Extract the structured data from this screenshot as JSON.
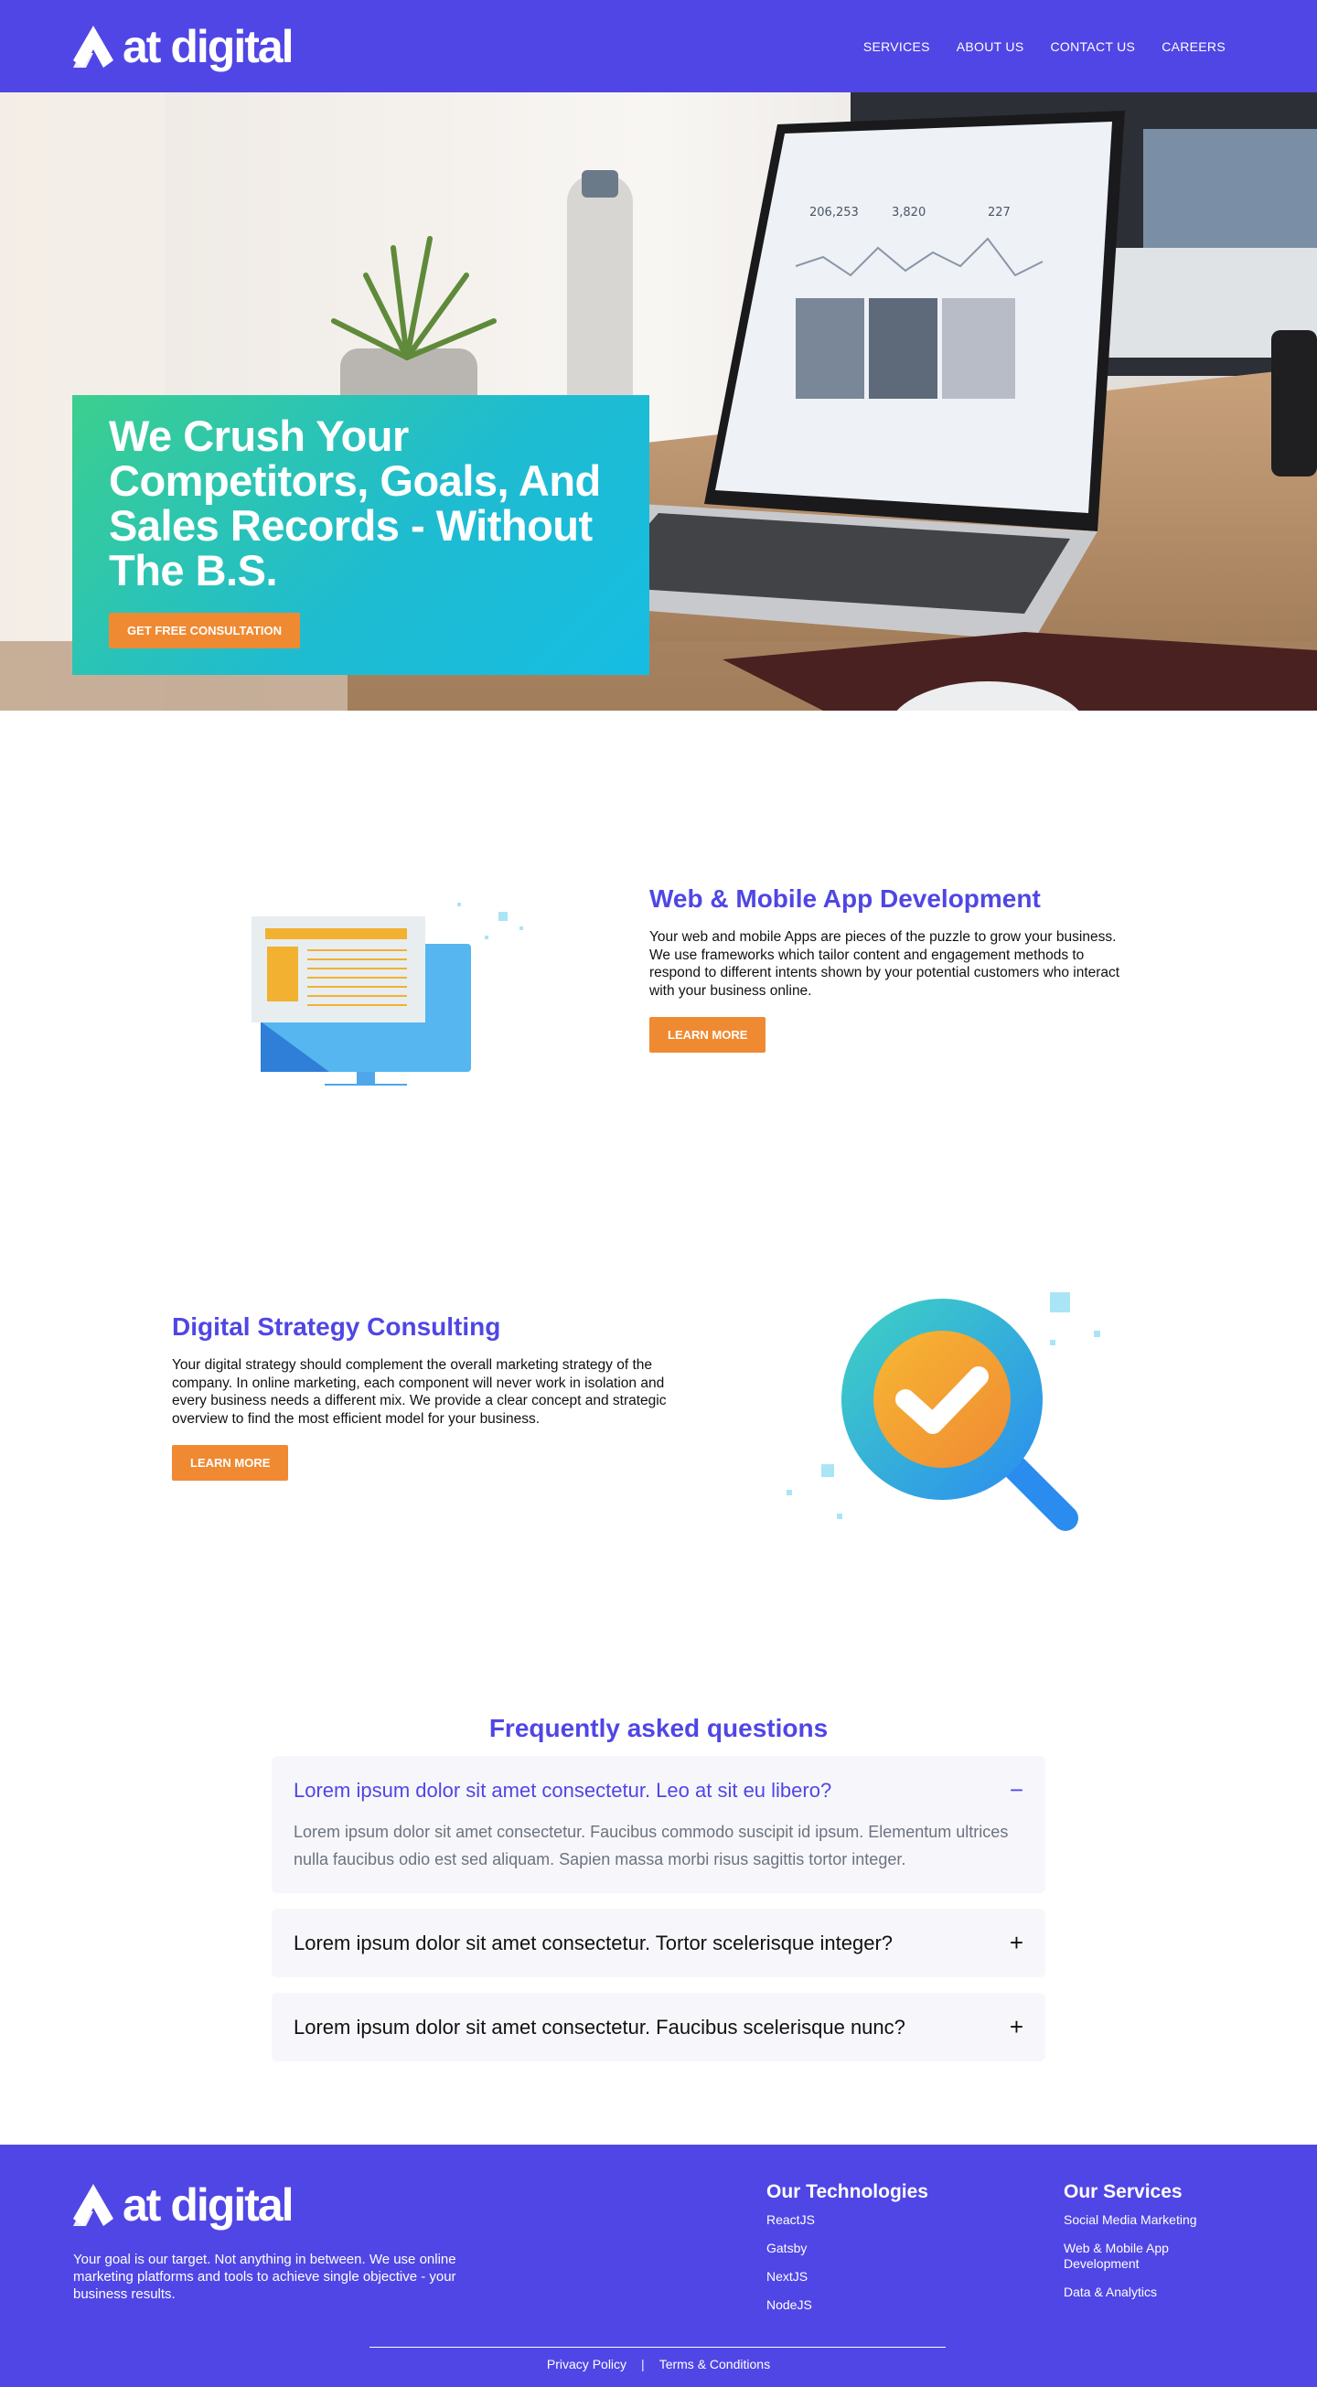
{
  "header": {
    "logo_text": "at digital",
    "nav": [
      "SERVICES",
      "ABOUT US",
      "CONTACT US",
      "CAREERS"
    ]
  },
  "hero": {
    "title": "We Crush Your Competitors, Goals, And Sales Records - Without The B.S.",
    "cta": "GET FREE CONSULTATION",
    "screen_stats": [
      "206,253",
      "3,820",
      "227"
    ]
  },
  "services": [
    {
      "title": "Web & Mobile App Development",
      "text": "Your web and mobile Apps are pieces of the puzzle to grow your business. We use frameworks which tailor content and engagement methods to respond to different intents shown by your potential customers who interact with your business online.",
      "cta": "LEARN MORE"
    },
    {
      "title": "Digital Strategy Consulting",
      "text": "Your digital strategy should complement the overall marketing strategy of the company. In online marketing, each component will never work in isolation and every business needs a different mix. We provide a clear concept and strategic overview to find the most efficient model for your business.",
      "cta": "LEARN MORE"
    }
  ],
  "faq": {
    "heading": "Frequently asked questions",
    "items": [
      {
        "question": "Lorem ipsum dolor sit amet consectetur. Leo at sit eu libero?",
        "answer": "Lorem ipsum dolor sit amet consectetur. Faucibus commodo suscipit id ipsum. Elementum ultrices nulla faucibus odio est sed aliquam. Sapien massa morbi risus sagittis tortor integer.",
        "icon": "−"
      },
      {
        "question": "Lorem ipsum dolor sit amet consectetur. Tortor scelerisque integer?",
        "icon": "+"
      },
      {
        "question": "Lorem ipsum dolor sit amet consectetur. Faucibus scelerisque nunc?",
        "icon": "+"
      }
    ]
  },
  "footer": {
    "logo_text": "at digital",
    "tagline": "Your goal is our target. Not anything in between. We use online marketing platforms and tools to achieve single objective - your business results.",
    "technologies": {
      "title": "Our Technologies",
      "items": [
        "ReactJS",
        "Gatsby",
        "NextJS",
        "NodeJS"
      ]
    },
    "services": {
      "title": "Our Services",
      "items": [
        "Social Media Marketing",
        "Web & Mobile App Development",
        "Data & Analytics"
      ]
    },
    "privacy": "Privacy Policy",
    "separator": "|",
    "terms": "Terms & Conditions"
  },
  "colors": {
    "brand": "#5046e5",
    "accent": "#ef8a33",
    "hero_gradient_start": "#3ccf8e",
    "hero_gradient_end": "#16bde3"
  }
}
